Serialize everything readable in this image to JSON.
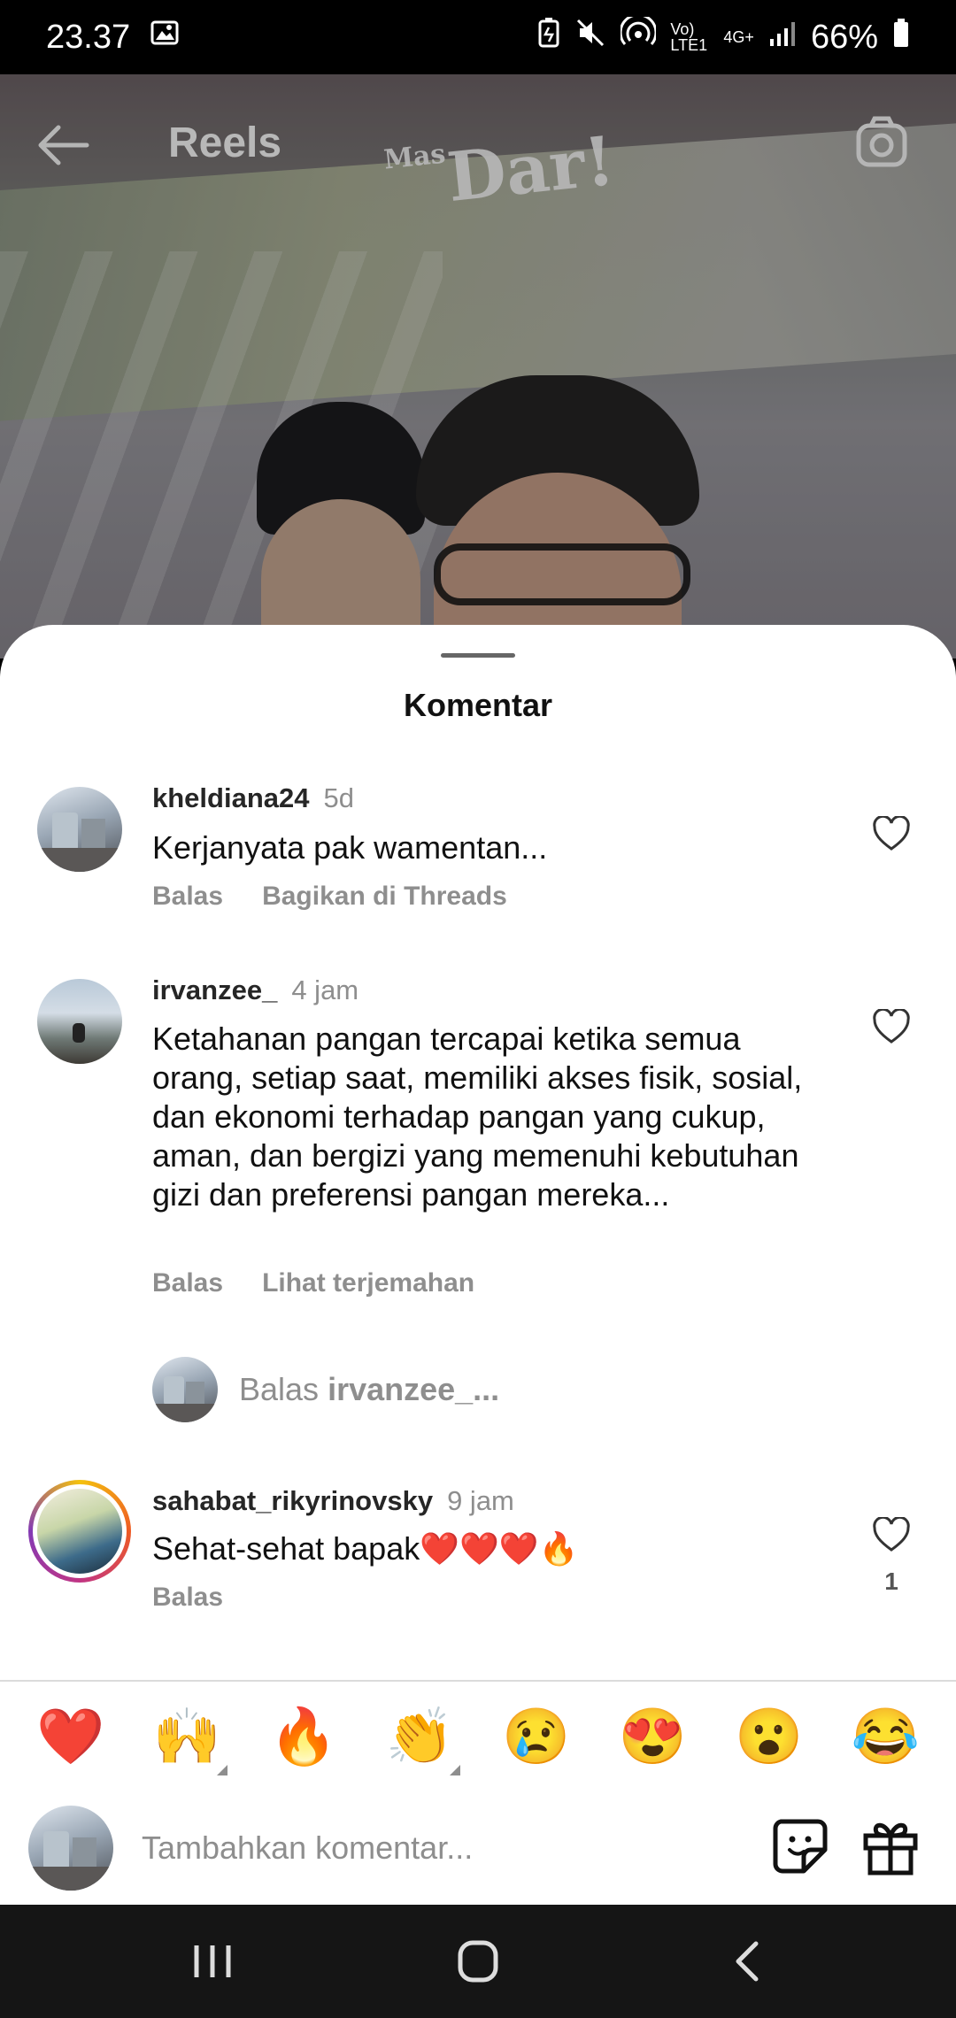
{
  "status_bar": {
    "time": "23.37",
    "network": "Vo) LTE1",
    "network_type": "4G+",
    "battery": "66%"
  },
  "header": {
    "title": "Reels",
    "video_logo": "Dar!",
    "video_logo_prefix": "Mas"
  },
  "sheet": {
    "title": "Komentar"
  },
  "comments": [
    {
      "username": "kheldiana24",
      "time": "5d",
      "text": "Kerjanyata pak wamentan...",
      "actions": [
        "Balas",
        "Bagikan di Threads"
      ]
    },
    {
      "username": "irvanzee_",
      "time": "4 jam",
      "text": "Ketahanan pangan tercapai ketika semua orang, setiap saat, memiliki akses fisik, sosial, dan ekonomi terhadap pangan yang cukup, aman, dan bergizi yang memenuhi kebutuhan gizi dan preferensi pangan mereka...",
      "actions": [
        "Balas",
        "Lihat terjemahan"
      ]
    },
    {
      "username": "sahabat_rikyrinovsky",
      "time": "9 jam",
      "text": "Sehat-sehat bapak❤️❤️❤️🔥",
      "actions": [
        "Balas"
      ],
      "likes": "1"
    }
  ],
  "reply_prompt": {
    "prefix": "Balas ",
    "username": "irvanzee_..."
  },
  "emojis": [
    "❤️",
    "🙌",
    "🔥",
    "👏",
    "😢",
    "😍",
    "😮",
    "😂"
  ],
  "composer": {
    "placeholder": "Tambahkan komentar..."
  },
  "icons": {
    "back": "arrow-left-icon",
    "camera": "camera-icon",
    "heart": "heart-outline-icon",
    "sticker": "sticker-icon",
    "gift": "gift-icon",
    "nav_recents": "recents-icon",
    "nav_home": "home-icon",
    "nav_back": "back-icon"
  }
}
